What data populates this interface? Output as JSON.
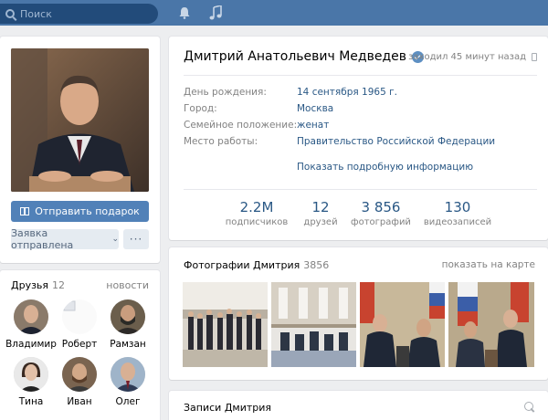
{
  "topbar": {
    "search_placeholder": "Поиск",
    "icons": [
      "bell-icon",
      "music-note-icon"
    ],
    "color": "#4a76a8"
  },
  "profile": {
    "name": "Дмитрий Анатольевич Медведев",
    "verified": true,
    "last_seen": "заходил 45 минут назад",
    "info": [
      {
        "label": "День рождения:",
        "value": "14 сентября 1965 г."
      },
      {
        "label": "Город:",
        "value": "Москва"
      },
      {
        "label": "Семейное положение:",
        "value": "женат"
      },
      {
        "label": "Место работы:",
        "value": "Правительство Российской Федерации"
      }
    ],
    "more_info_link": "Показать подробную информацию",
    "stats": [
      {
        "number": "2.2M",
        "label": "подписчиков"
      },
      {
        "number": "12",
        "label": "друзей"
      },
      {
        "number": "3 856",
        "label": "фотографий"
      },
      {
        "number": "130",
        "label": "видеозаписей"
      }
    ]
  },
  "actions": {
    "send_gift": "Отправить подарок",
    "request_sent": "Заявка отправлена",
    "more": "···"
  },
  "friends": {
    "title": "Друзья",
    "count": "12",
    "news_link": "новости",
    "items": [
      {
        "name": "Владимир"
      },
      {
        "name": "Роберт"
      },
      {
        "name": "Рамзан"
      },
      {
        "name": "Тина"
      },
      {
        "name": "Иван"
      },
      {
        "name": "Олег"
      }
    ]
  },
  "photos": {
    "title": "Фотографии Дмитрия",
    "count": "3856",
    "map_link": "показать на карте"
  },
  "posts": {
    "title": "Записи Дмитрия"
  }
}
